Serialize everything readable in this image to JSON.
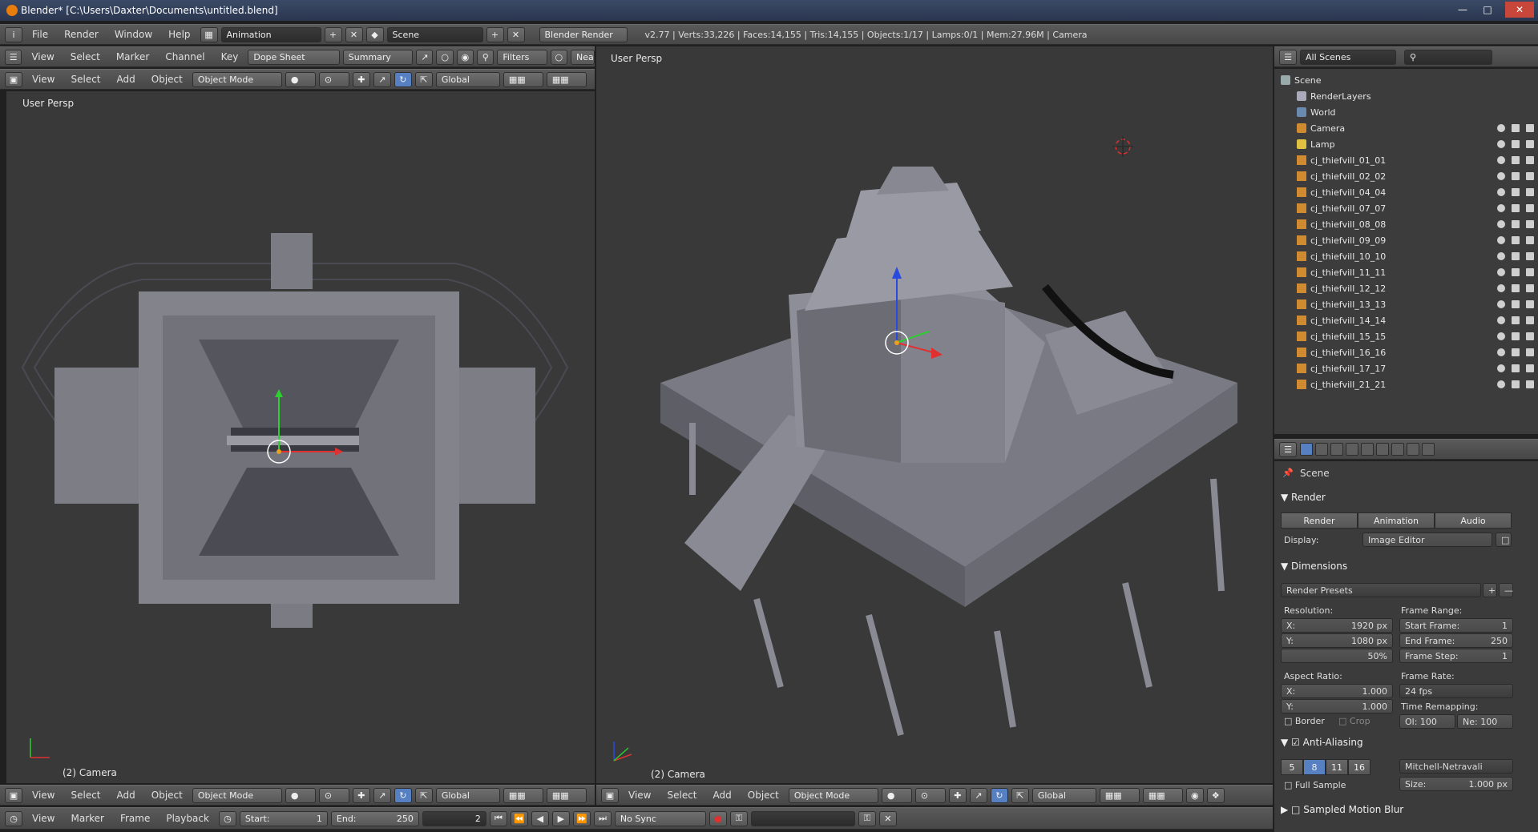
{
  "window": {
    "title": "Blender* [C:\\Users\\Daxter\\Documents\\untitled.blend]"
  },
  "info_bar": {
    "menus": [
      "File",
      "Render",
      "Window",
      "Help"
    ],
    "screen_layout": "Animation",
    "scene": "Scene",
    "engine": "Blender Render",
    "stats": "v2.77 | Verts:33,226 | Faces:14,155 | Tris:14,155 | Objects:1/17 | Lamps:0/1 | Mem:27.96M | Camera"
  },
  "dopesheet_header": {
    "menus": [
      "View",
      "Select",
      "Marker",
      "Channel",
      "Key"
    ],
    "mode": "Dope Sheet",
    "summary": "Summary",
    "filters": "Filters",
    "near": "Nea"
  },
  "left_view": {
    "header_menus": [
      "View",
      "Select",
      "Add",
      "Object"
    ],
    "mode": "Object Mode",
    "orientation": "Global",
    "label": "User Persp",
    "footer": "(2) Camera"
  },
  "right_view": {
    "label": "User Persp",
    "footer": "(2) Camera",
    "header_menus": [
      "View",
      "Select",
      "Add",
      "Object"
    ],
    "mode": "Object Mode",
    "orientation": "Global"
  },
  "timeline": {
    "menus": [
      "View",
      "Marker",
      "Frame",
      "Playback"
    ],
    "start_label": "Start:",
    "start": "1",
    "end_label": "End:",
    "end": "250",
    "current": "2",
    "sync": "No Sync"
  },
  "outliner": {
    "filter": "All Scenes",
    "items": [
      "Scene",
      "RenderLayers",
      "World",
      "Camera",
      "Lamp",
      "cj_thiefvill_01_01",
      "cj_thiefvill_02_02",
      "cj_thiefvill_04_04",
      "cj_thiefvill_07_07",
      "cj_thiefvill_08_08",
      "cj_thiefvill_09_09",
      "cj_thiefvill_10_10",
      "cj_thiefvill_11_11",
      "cj_thiefvill_12_12",
      "cj_thiefvill_13_13",
      "cj_thiefvill_14_14",
      "cj_thiefvill_15_15",
      "cj_thiefvill_16_16",
      "cj_thiefvill_17_17",
      "cj_thiefvill_21_21"
    ]
  },
  "properties": {
    "context": "Scene",
    "render_section": "Render",
    "render_btn": "Render",
    "animation_btn": "Animation",
    "audio_btn": "Audio",
    "display_label": "Display:",
    "display_value": "Image Editor",
    "dimensions_section": "Dimensions",
    "presets": "Render Presets",
    "resolution_label": "Resolution:",
    "res_x": "X:",
    "res_x_val": "1920 px",
    "res_y": "Y:",
    "res_y_val": "1080 px",
    "res_pct": "50%",
    "frame_range_label": "Frame Range:",
    "start_frame": "Start Frame:",
    "start_frame_val": "1",
    "end_frame": "End Frame:",
    "end_frame_val": "250",
    "frame_step": "Frame Step:",
    "frame_step_val": "1",
    "aspect_label": "Aspect Ratio:",
    "asp_x": "X:",
    "asp_x_val": "1.000",
    "asp_y": "Y:",
    "asp_y_val": "1.000",
    "frame_rate_label": "Frame Rate:",
    "fps": "24 fps",
    "time_remap_label": "Time Remapping:",
    "old": "Ol: 100",
    "new": "Ne: 100",
    "border": "Border",
    "crop": "Crop",
    "aa_section": "Anti-Aliasing",
    "aa_samples": [
      "5",
      "8",
      "11",
      "16"
    ],
    "filter": "Mitchell-Netravali",
    "full_sample": "Full Sample",
    "size": "Size:",
    "size_val": "1.000 px",
    "motion_blur": "Sampled Motion Blur"
  },
  "colors": {
    "accent": "#5680c2",
    "viewport_bg": "#393939",
    "header": "#4f4f4f"
  }
}
